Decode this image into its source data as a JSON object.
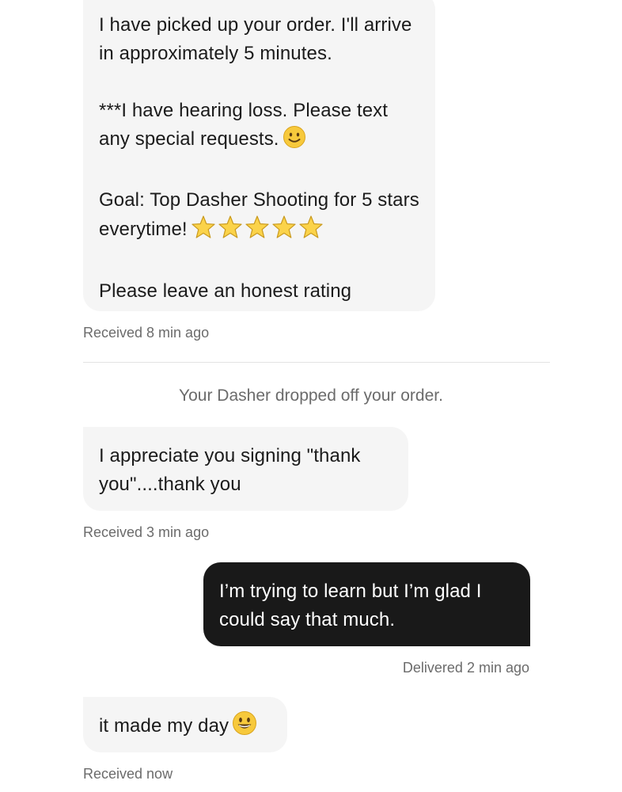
{
  "messages": [
    {
      "direction": "incoming",
      "paragraphs": [
        "I have picked up your order. I'll arrive in approximately 5 minutes.",
        "***I have hearing loss. Please text any special requests.",
        "Goal: Top Dasher Shooting for 5 stars everytime!",
        "Please leave an honest rating"
      ],
      "status": "Received 8 min ago"
    },
    {
      "direction": "incoming",
      "text": "I appreciate you signing \"thank you\"....thank you",
      "status": "Received 3 min ago"
    },
    {
      "direction": "outgoing",
      "text": "I’m trying to learn but I’m glad I could say that much.",
      "status": "Delivered 2 min ago"
    },
    {
      "direction": "incoming",
      "text": "it made my day",
      "status": "Received now"
    }
  ],
  "system_note": "Your Dasher dropped off your order.",
  "icons": {
    "smile": "slightly-smiling-face-icon",
    "star": "star-icon",
    "grin": "grinning-face-icon"
  },
  "colors": {
    "incoming_bubble": "#f5f5f5",
    "outgoing_bubble": "#191919",
    "meta_text": "#6b6b6b",
    "emoji_face": "#f7c93c",
    "star": "#fbd34a"
  }
}
